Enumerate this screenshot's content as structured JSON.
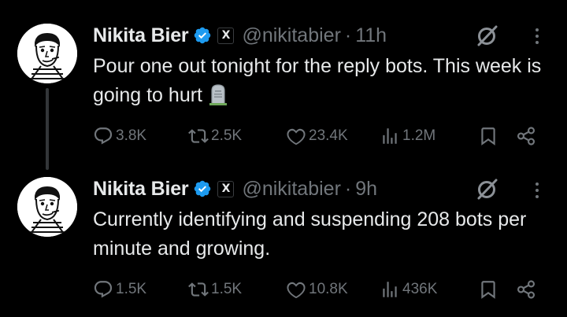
{
  "thread": [
    {
      "author": {
        "name": "Nikita Bier",
        "handle": "@nikitabier",
        "affiliate_badge": "X",
        "verified_icon": "verified-badge-icon"
      },
      "separator": "·",
      "time": "11h",
      "text": "Pour one out tonight for the reply bots. This week is going to hurt",
      "emoji": "tombstone-icon",
      "stats": {
        "replies": "3.8K",
        "reposts": "2.5K",
        "likes": "23.4K",
        "views": "1.2M"
      }
    },
    {
      "author": {
        "name": "Nikita Bier",
        "handle": "@nikitabier",
        "affiliate_badge": "X",
        "verified_icon": "verified-badge-icon"
      },
      "separator": "·",
      "time": "9h",
      "text": "Currently identifying and suspending 208 bots per minute and growing.",
      "stats": {
        "replies": "1.5K",
        "reposts": "1.5K",
        "likes": "10.8K",
        "views": "436K"
      }
    }
  ],
  "colors": {
    "background": "#000000",
    "primary_text": "#e7e9ea",
    "secondary_text": "#71767b",
    "verified_blue": "#1d9bf0",
    "thread_line": "#333639"
  }
}
